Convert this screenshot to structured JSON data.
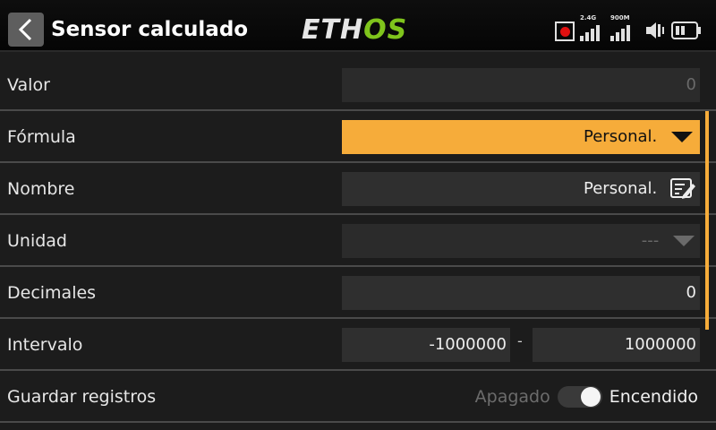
{
  "header": {
    "title": "Sensor calculado",
    "logo_eth": "ETH",
    "logo_os": "OS",
    "signal1_label": "2.4G",
    "signal2_label": "900M"
  },
  "icons": {
    "back": "chevron-left-icon",
    "record": "record-icon",
    "signal": "signal-bars-icon",
    "speaker": "speaker-icon",
    "battery": "battery-icon",
    "dropdown": "caret-down-icon",
    "edit": "edit-icon"
  },
  "colors": {
    "accent": "#f6ac3a",
    "logo_green": "#7fc41c",
    "record_red": "#e01010"
  },
  "rows": {
    "valor": {
      "label": "Valor",
      "value": "0"
    },
    "formula": {
      "label": "Fórmula",
      "value": "Personal."
    },
    "nombre": {
      "label": "Nombre",
      "value": "Personal."
    },
    "unidad": {
      "label": "Unidad",
      "value": "---"
    },
    "decimales": {
      "label": "Decimales",
      "value": "0"
    },
    "intervalo": {
      "label": "Intervalo",
      "min": "-1000000",
      "separator": "-",
      "max": "1000000"
    },
    "guardar": {
      "label": "Guardar registros",
      "off_label": "Apagado",
      "on_label": "Encendido",
      "state": "on"
    }
  }
}
